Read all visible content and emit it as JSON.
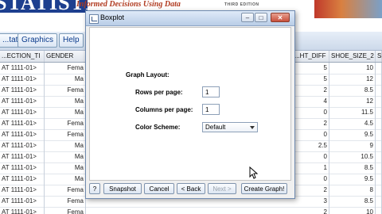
{
  "banner": {
    "title": "STATISTICS",
    "tagline": "Informed Decisions Using Data",
    "edition": "THIRD EDITION"
  },
  "menu": {
    "items": [
      "...tat",
      "Graphics",
      "Help"
    ],
    "extra": ""
  },
  "table": {
    "headers": [
      "...ECTION_TI",
      "GENDER",
      "...HT_DIFF",
      "SHOE_SIZE_2",
      "S"
    ],
    "rows": [
      [
        "AT 1111-01>",
        "Fema",
        "5",
        "10",
        ""
      ],
      [
        "AT 1111-01>",
        "Ma",
        "5",
        "12",
        ""
      ],
      [
        "AT 1111-01>",
        "Fema",
        "2",
        "8.5",
        ""
      ],
      [
        "AT 1111-01>",
        "Ma",
        "4",
        "12",
        ""
      ],
      [
        "AT 1111-01>",
        "Ma",
        "0",
        "11.5",
        ""
      ],
      [
        "AT 1111-01>",
        "Fema",
        "2",
        "4.5",
        ""
      ],
      [
        "AT 1111-01>",
        "Fema",
        "0",
        "9.5",
        ""
      ],
      [
        "AT 1111-01>",
        "Ma",
        "2.5",
        "9",
        ""
      ],
      [
        "AT 1111-01>",
        "Ma",
        "0",
        "10.5",
        ""
      ],
      [
        "AT 1111-01>",
        "Ma",
        "1",
        "8.5",
        ""
      ],
      [
        "AT 1111-01>",
        "Ma",
        "0",
        "9.5",
        ""
      ],
      [
        "AT 1111-01>",
        "Fema",
        "2",
        "8",
        ""
      ],
      [
        "AT 1111-01>",
        "Fema",
        "3",
        "8.5",
        ""
      ],
      [
        "AT 1111-01>",
        "Fema",
        "2",
        "10",
        ""
      ]
    ]
  },
  "dialog": {
    "title": "Boxplot",
    "section_label": "Graph Layout:",
    "rows_label": "Rows per page:",
    "rows_value": "1",
    "cols_label": "Columns per page:",
    "cols_value": "1",
    "scheme_label": "Color Scheme:",
    "scheme_value": "Default",
    "buttons": {
      "help": "?",
      "snapshot": "Snapshot",
      "cancel": "Cancel",
      "back": "< Back",
      "next": "Next >",
      "create": "Create Graph!"
    }
  },
  "colors": {
    "banner_blue": "#1d3f8f",
    "tagline_red": "#b03a1f",
    "menu_text": "#0b3b8c"
  }
}
